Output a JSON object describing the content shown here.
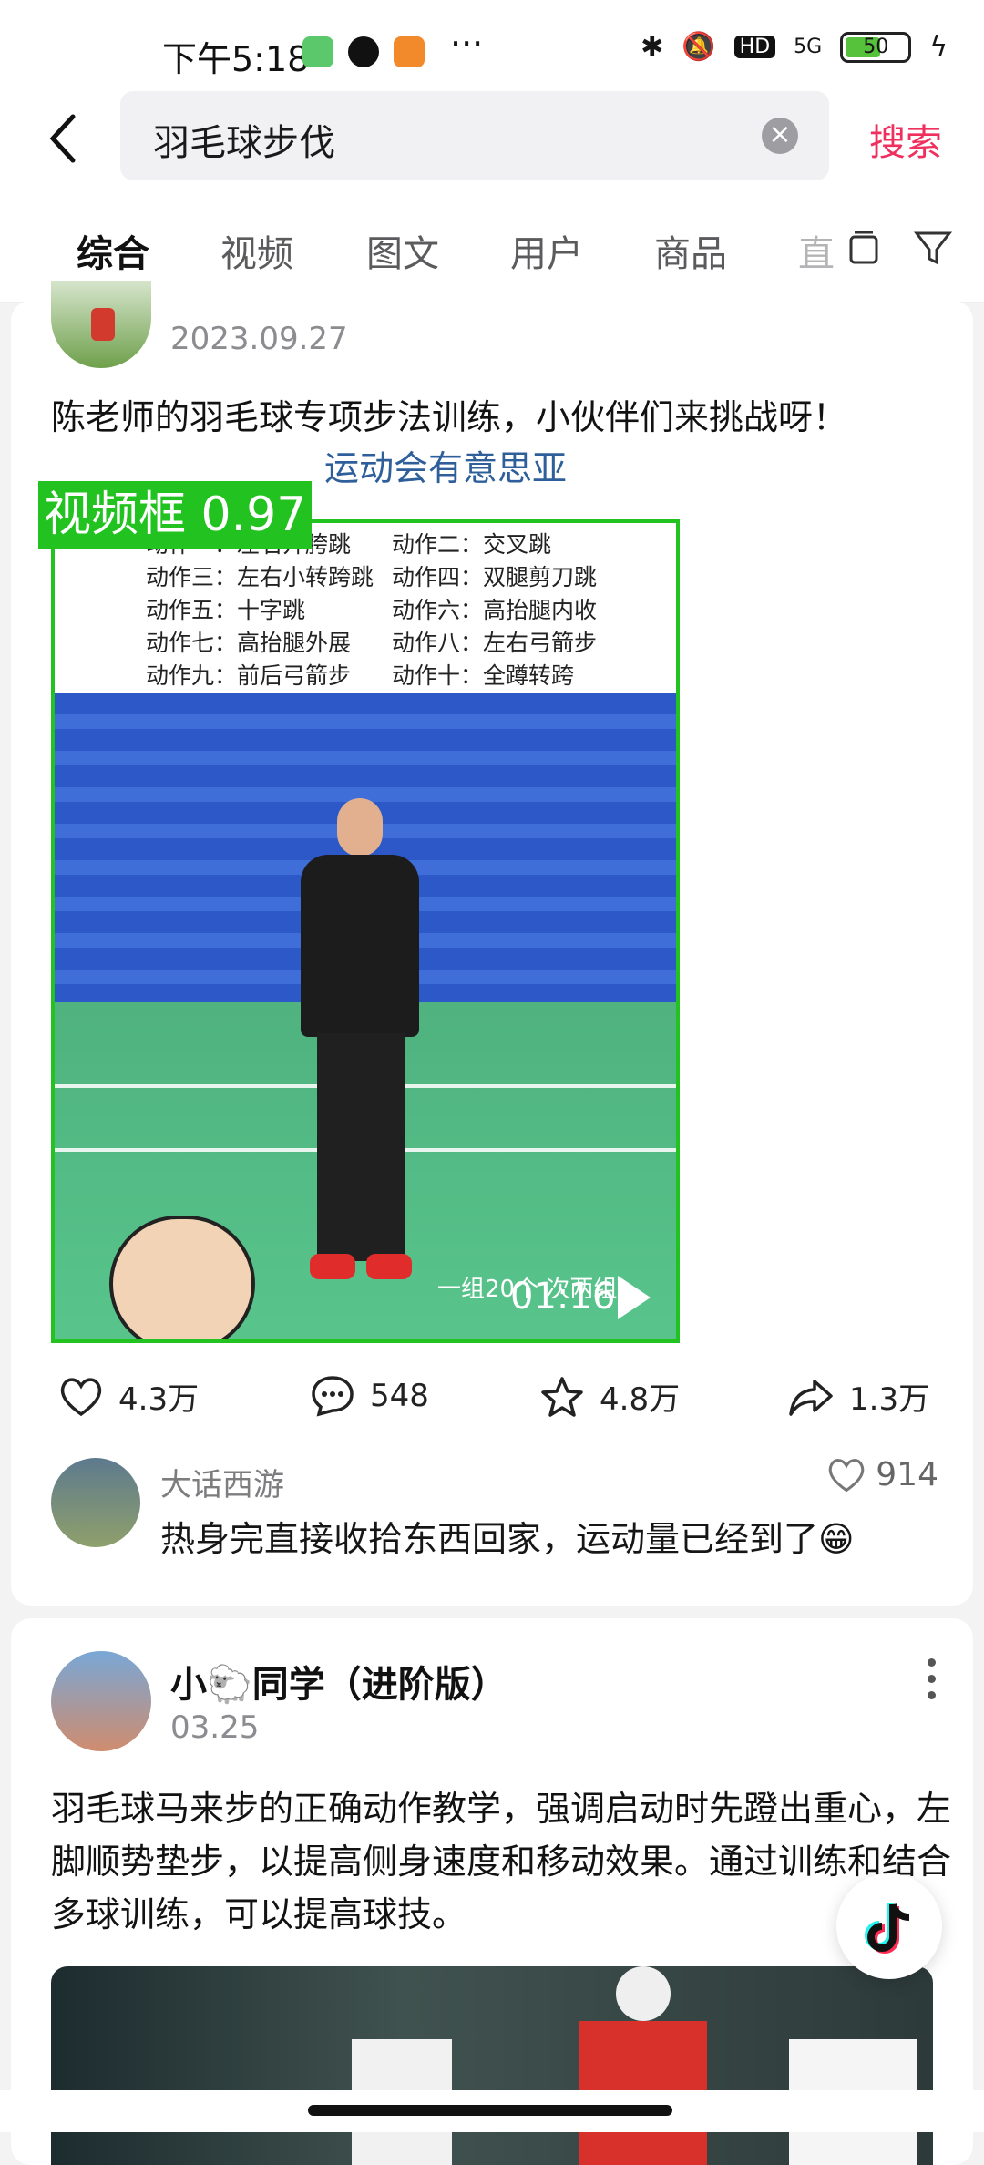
{
  "status_bar": {
    "time": "下午5:18",
    "apps": [
      "wechat-like-icon",
      "qq-icon",
      "58-icon"
    ],
    "dots": "···",
    "network": "5G",
    "hd": "HD",
    "battery": "50"
  },
  "header": {
    "query": "羽毛球步伐",
    "search_button": "搜索"
  },
  "tabs": [
    "综合",
    "视频",
    "图文",
    "用户",
    "商品",
    "直"
  ],
  "post1": {
    "date": "2023.09.27",
    "text": "陈老师的羽毛球专项步法训练，小伙伴们来挑战呀！",
    "link_text": "运动会有意思亚",
    "video": {
      "actions": [
        [
          "动作一：左右开胯跳",
          "动作二：交叉跳"
        ],
        [
          "动作三：左右小转跨跳",
          "动作四：双腿剪刀跳"
        ],
        [
          "动作五：十字跳",
          "动作六：高抬腿内收"
        ],
        [
          "动作七：高抬腿外展",
          "动作八：左右弓箭步"
        ],
        [
          "动作九：前后弓箭步",
          "动作十：全蹲转跨"
        ]
      ],
      "bottom_text": "一组20个   次两组",
      "duration": "01:16",
      "detection_label": "视频框 0.97"
    },
    "stats": {
      "likes": "4.3万",
      "comments": "548",
      "favorites": "4.8万",
      "shares": "1.3万"
    },
    "top_comment": {
      "user": "大话西游",
      "likes": "914",
      "text": "热身完直接收拾东西回家，运动量已经到了😁"
    }
  },
  "post2": {
    "user": "小🐑同学（进阶版）",
    "date": "03.25",
    "text": "羽毛球马来步的正确动作教学，强调启动时先蹬出重心，左脚顺势垫步，以提高侧身速度和移动效果。通过训练和结合多球训练，可以提高球技。"
  },
  "colors": {
    "accent": "#ef2f5d",
    "link": "#2f5f9a",
    "detection": "#22c320"
  }
}
